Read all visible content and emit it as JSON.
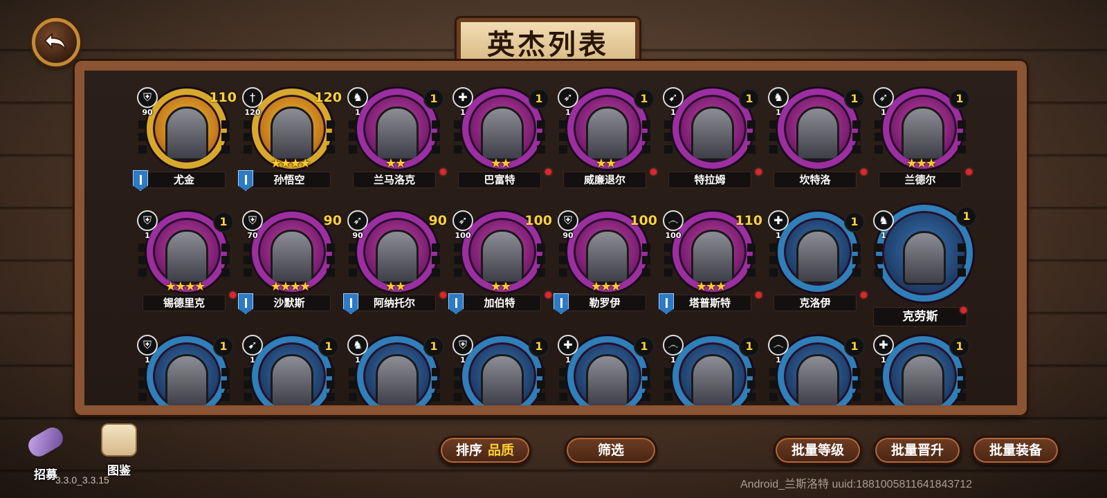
{
  "title": "英杰列表",
  "row1": [
    {
      "name": "尤金",
      "cls": "⛨",
      "cls_lvl": "90",
      "lvl": "110",
      "frame": "gold",
      "stars": "",
      "flag": true,
      "dot": false
    },
    {
      "name": "孙悟空",
      "cls": "†",
      "cls_lvl": "120",
      "lvl": "120",
      "frame": "gold",
      "stars": "★★★★",
      "flag": true,
      "dot": false
    },
    {
      "name": "兰马洛克",
      "cls": "♞",
      "cls_lvl": "1",
      "lvl": "1",
      "frame": "purple",
      "stars": "★★",
      "flag": false,
      "dot": true
    },
    {
      "name": "巴富特",
      "cls": "✚",
      "cls_lvl": "1",
      "lvl": "1",
      "frame": "purple",
      "stars": "★★",
      "flag": false,
      "dot": true
    },
    {
      "name": "威廉退尔",
      "cls": "➶",
      "cls_lvl": "1",
      "lvl": "1",
      "frame": "purple",
      "stars": "★★",
      "flag": false,
      "dot": true
    },
    {
      "name": "特拉姆",
      "cls": "➹",
      "cls_lvl": "1",
      "lvl": "1",
      "frame": "purple",
      "stars": "",
      "flag": false,
      "dot": true
    },
    {
      "name": "坎特洛",
      "cls": "♞",
      "cls_lvl": "1",
      "lvl": "1",
      "frame": "purple",
      "stars": "",
      "flag": false,
      "dot": true
    },
    {
      "name": "兰德尔",
      "cls": "➶",
      "cls_lvl": "1",
      "lvl": "1",
      "frame": "purple",
      "stars": "★★★",
      "flag": false,
      "dot": true
    }
  ],
  "row2": [
    {
      "name": "锡德里克",
      "cls": "⛨",
      "cls_lvl": "1",
      "lvl": "1",
      "frame": "purple",
      "stars": "★★★★",
      "flag": false,
      "dot": true
    },
    {
      "name": "沙默斯",
      "cls": "⛨",
      "cls_lvl": "70",
      "lvl": "90",
      "frame": "purple",
      "stars": "★★★★",
      "flag": true,
      "dot": false
    },
    {
      "name": "阿纳托尔",
      "cls": "➶",
      "cls_lvl": "90",
      "lvl": "90",
      "frame": "purple",
      "stars": "★★",
      "flag": true,
      "dot": true
    },
    {
      "name": "加伯特",
      "cls": "➶",
      "cls_lvl": "100",
      "lvl": "100",
      "frame": "purple",
      "stars": "★★",
      "flag": true,
      "dot": true
    },
    {
      "name": "勒罗伊",
      "cls": "⛨",
      "cls_lvl": "90",
      "lvl": "100",
      "frame": "purple",
      "stars": "★★★",
      "flag": true,
      "dot": false
    },
    {
      "name": "塔普斯特",
      "cls": "෴",
      "cls_lvl": "100",
      "lvl": "110",
      "frame": "purple",
      "stars": "★★★",
      "flag": true,
      "dot": true
    },
    {
      "name": "克洛伊",
      "cls": "✚",
      "cls_lvl": "1",
      "lvl": "1",
      "frame": "blue",
      "stars": "",
      "flag": false,
      "dot": true
    },
    {
      "name": "克劳斯",
      "cls": "♞",
      "cls_lvl": "1",
      "lvl": "1",
      "frame": "blue",
      "stars": "",
      "flag": false,
      "dot": true
    }
  ],
  "row3": [
    {
      "cls": "⛨",
      "cls_lvl": "1",
      "lvl": "1"
    },
    {
      "cls": "➹",
      "cls_lvl": "1",
      "lvl": "1"
    },
    {
      "cls": "♞",
      "cls_lvl": "1",
      "lvl": "1"
    },
    {
      "cls": "⛨",
      "cls_lvl": "1",
      "lvl": "1"
    },
    {
      "cls": "✚",
      "cls_lvl": "1",
      "lvl": "1"
    },
    {
      "cls": "෴",
      "cls_lvl": "1",
      "lvl": "1"
    },
    {
      "cls": "෴",
      "cls_lvl": "1",
      "lvl": "1"
    },
    {
      "cls": "✚",
      "cls_lvl": "1",
      "lvl": "1"
    }
  ],
  "bottom": {
    "recruit_label": "招募",
    "codex_label": "图鉴",
    "sort_label": "排序",
    "sort_value": "品质",
    "filter_label": "筛选",
    "batch_level_label": "批量等级",
    "batch_promote_label": "批量晋升",
    "batch_equip_label": "批量装备"
  },
  "version": "3.3.0_3.3.15",
  "uuid_text": "Android_兰斯洛特 uuid:1881005811641843712"
}
